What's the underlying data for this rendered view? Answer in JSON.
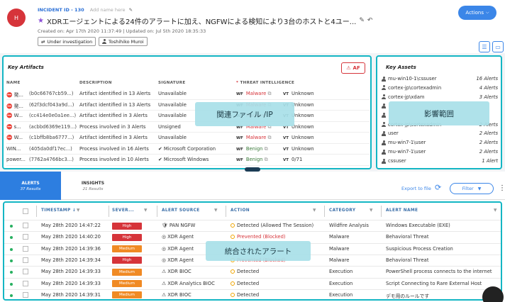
{
  "header": {
    "avatar_letter": "H",
    "incident_id": "INCIDENT ID - 130",
    "add_name_placeholder": "Add name here",
    "title": "XDRエージェントによる24件のアラートに加え、NGFWによる検知により3台のホストと4ユー...",
    "created": "Created on: Apr 17th 2020 11:37:49",
    "updated": "Updated on: Jul 5th 2020 18:35:33",
    "status_chip": "Under investigation",
    "assignee_chip": "Toshihiko Muroi",
    "actions_label": "Actions"
  },
  "key_artifacts": {
    "title": "Key Artifacts",
    "af_button": "AF",
    "columns": [
      "NAME",
      "DESCRIPTION",
      "SIGNATURE",
      "THREAT INTELLIGENCE"
    ],
    "rows": [
      {
        "name": "発...",
        "hash": "(b0c66767cb59...)",
        "desc": "Artifact identified in 13 Alerts",
        "sig": "Unavailable",
        "wf": "Malware",
        "vt": "Unknown"
      },
      {
        "name": "発...",
        "hash": "(62f3dcf043a9d...)",
        "desc": "Artifact identified in 13 Alerts",
        "sig": "Unavailable",
        "wf": "Malware",
        "vt": "Unknown"
      },
      {
        "name": "W...",
        "hash": "(cc414e0e0a1ee...)",
        "desc": "Artifact identified in 3 Alerts",
        "sig": "Unavailable",
        "wf": "Malware",
        "vt": "Unknown"
      },
      {
        "name": "s...",
        "hash": "(acbbd6369e119...)",
        "desc": "Process involved in 3 Alerts",
        "sig": "Unsigned",
        "wf": "Malware",
        "vt": "Unknown"
      },
      {
        "name": "W...",
        "hash": "(c1bffb8ba6777...)",
        "desc": "Artifact identified in 3 Alerts",
        "sig": "Unavailable",
        "wf": "Malware",
        "vt": "Unknown"
      },
      {
        "name": "WIN...",
        "hash": "(405da0df17ec...)",
        "desc": "Process involved in 16 Alerts",
        "sig": "Microsoft Corporation",
        "wf": "Benign",
        "vt": "Unknown"
      },
      {
        "name": "power...",
        "hash": "(7762a4766bc3...)",
        "desc": "Process involved in 10 Alerts",
        "sig": "Microsoft Windows",
        "wf": "Benign",
        "vt": "0/71"
      }
    ],
    "overlay": "関連ファイル /IP"
  },
  "key_assets": {
    "title": "Key Assets",
    "rows": [
      {
        "name": "mu-win10-1\\cssuser",
        "count": "16 Alerts"
      },
      {
        "name": "cortex-jp\\cortexadmin",
        "count": "4 Alerts"
      },
      {
        "name": "cortex-jp\\xdam",
        "count": "3 Alerts"
      },
      {
        "name": "",
        "count": ""
      },
      {
        "name": "",
        "count": ""
      },
      {
        "name": "cortex-jp\\cortexadmin",
        "count": "2 Alerts"
      },
      {
        "name": "user",
        "count": "2 Alerts"
      },
      {
        "name": "mu-win7-1\\user",
        "count": "2 Alerts"
      },
      {
        "name": "mu-win7-1\\user",
        "count": "2 Alerts"
      },
      {
        "name": "cssuser",
        "count": "1 Alert"
      }
    ],
    "overlay": "影響範囲"
  },
  "tabs": {
    "alerts": {
      "label": "ALERTS",
      "sub": "37 Results"
    },
    "insights": {
      "label": "INSIGHTS",
      "sub": "21 Results"
    }
  },
  "toolbar": {
    "export": "Export to file",
    "filter": "Filter"
  },
  "alerts_table": {
    "columns": [
      "TIMESTAMP",
      "SEVER...",
      "ALERT SOURCE",
      "ACTION",
      "CATEGORY",
      "ALERT NAME"
    ],
    "rows": [
      {
        "ts": "May 28th 2020 14:47:22",
        "sev": "High",
        "src": "PAN NGFW",
        "action": "Detected (Allowed The Session)",
        "cat": "Wildfire Analysis",
        "name": "Windows Executable (EXE)"
      },
      {
        "ts": "May 28th 2020 14:40:20",
        "sev": "High",
        "src": "XDR Agent",
        "action": "Prevented (Blocked)",
        "cat": "Malware",
        "name": "Behavioral Threat"
      },
      {
        "ts": "May 28th 2020 14:39:36",
        "sev": "Medium",
        "src": "XDR Agent",
        "action": "",
        "cat": "Malware",
        "name": "Suspicious Process Creation"
      },
      {
        "ts": "May 28th 2020 14:39:34",
        "sev": "High",
        "src": "XDR Agent",
        "action": "Prevented (Blocked)",
        "cat": "Malware",
        "name": "Behavioral Threat"
      },
      {
        "ts": "May 28th 2020 14:39:33",
        "sev": "Medium",
        "src": "XDR BIOC",
        "action": "Detected",
        "cat": "Execution",
        "name": "PowerShell process connects to the internet"
      },
      {
        "ts": "May 28th 2020 14:39:33",
        "sev": "Medium",
        "src": "XDR Analytics BIOC",
        "action": "Detected",
        "cat": "Execution",
        "name": "Script Connecting to Rare External Host"
      },
      {
        "ts": "May 28th 2020 14:39:31",
        "sev": "Medium",
        "src": "XDR BIOC",
        "action": "Detected",
        "cat": "Execution",
        "name": "デモ用のルールです"
      }
    ],
    "overlay": "統合されたアラート"
  },
  "colors": {
    "accent": "#3b86e8",
    "highlight_border": "#14b6c4",
    "high": "#d6343a",
    "medium": "#f08a24"
  }
}
